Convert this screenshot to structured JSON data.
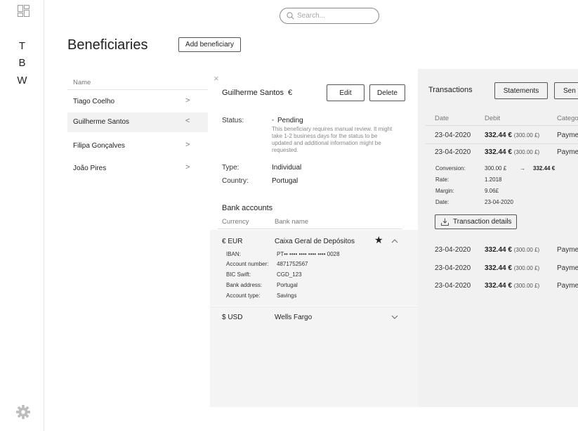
{
  "sidebar": {
    "letters": [
      "T",
      "B",
      "W"
    ]
  },
  "search": {
    "placeholder": "Search..."
  },
  "page": {
    "title": "Beneficiaries",
    "add_label": "Add beneficiary"
  },
  "list": {
    "header": "Name",
    "items": [
      {
        "name": "Tiago Coelho",
        "chevron": ">"
      },
      {
        "name": "Guilherme Santos",
        "chevron": "<"
      },
      {
        "name": "Filipa Gonçalves",
        "chevron": ">"
      },
      {
        "name": "João Pires",
        "chevron": ">"
      }
    ]
  },
  "detail": {
    "close": "×",
    "name": "Guilherme Santos",
    "dot": "•",
    "currency": "€",
    "edit": "Edit",
    "delete": "Delete",
    "status_label": "Status:",
    "status_value": "Pending",
    "status_note_1": "This beneficiary requires manual review. It might",
    "status_note_2": "take 1-2 business days for the status to be",
    "status_note_3": "updated and additional information might be",
    "status_note_4": "requested.",
    "type_label": "Type:",
    "type_value": "Individual",
    "country_label": "Country:",
    "country_value": "Portugal",
    "bank_title": "Bank accounts",
    "col_currency": "Currency",
    "col_bank": "Bank name",
    "accounts": [
      {
        "currency": "€ EUR",
        "bank": "Caixa Geral de Depósitos",
        "fields": [
          {
            "k": "IBAN:",
            "v": "PT•• •••• •••• •••• •••• 0028"
          },
          {
            "k": "Account number:",
            "v": "4871752567"
          },
          {
            "k": "BIC Swift:",
            "v": "CGD_123"
          },
          {
            "k": "Bank address:",
            "v": "Portugal"
          },
          {
            "k": "Account type:",
            "v": "Savings"
          }
        ]
      },
      {
        "currency": "$ USD",
        "bank": "Wells Fargo"
      }
    ]
  },
  "transactions": {
    "title": "Transactions",
    "statements": "Statements",
    "send": "Sen",
    "col_date": "Date",
    "col_debit": "Debit",
    "col_category": "Catego",
    "rows": [
      {
        "date": "23-04-2020",
        "amount": "332.44 €",
        "sub": "(300.00 £)",
        "cat": "Payme"
      },
      {
        "date": "23-04-2020",
        "amount": "332.44 €",
        "sub": "(300.00 £)",
        "cat": "Payme"
      },
      {
        "date": "23-04-2020",
        "amount": "332.44 €",
        "sub": "(300.00 £)",
        "cat": "Payme"
      },
      {
        "date": "23-04-2020",
        "amount": "332.44 €",
        "sub": "(300.00 £)",
        "cat": "Payme"
      },
      {
        "date": "23-04-2020",
        "amount": "332.44 €",
        "sub": "(300.00 £)",
        "cat": "Payme"
      }
    ],
    "expanded": {
      "conversion_label": "Conversion:",
      "conversion_from": "300.00 £",
      "arrow": "→",
      "conversion_to": "332.44 €",
      "rate_label": "Rate:",
      "rate_value": "1.2018",
      "margin_label": "Margin:",
      "margin_value": "9.06£",
      "date_label": "Date:",
      "date_value": "23-04-2020",
      "details_button": "Transaction details"
    }
  }
}
